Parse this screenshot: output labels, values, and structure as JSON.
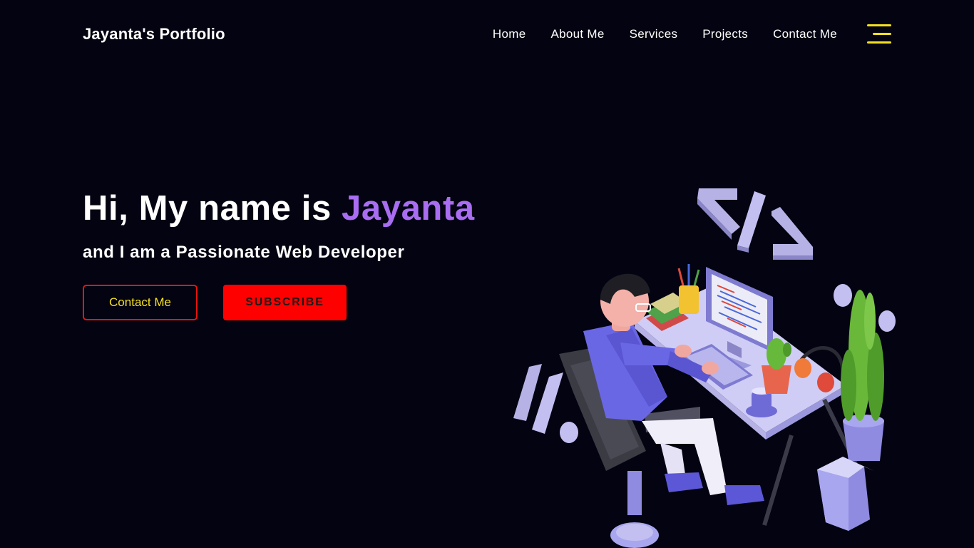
{
  "navbar": {
    "brand": "Jayanta's Portfolio",
    "links": [
      {
        "label": "Home"
      },
      {
        "label": "About Me"
      },
      {
        "label": "Services"
      },
      {
        "label": "Projects"
      },
      {
        "label": "Contact Me"
      }
    ],
    "menu_icon": "hamburger-menu-icon"
  },
  "hero": {
    "title_prefix": "Hi, My name is ",
    "title_name": "Jayanta",
    "subtitle": "and I am a Passionate Web Developer",
    "contact_button": "Contact Me",
    "subscribe_button": "SUBSCRIBE"
  },
  "illustration": {
    "subject": "developer-at-desk-illustration",
    "code_symbol": "</>"
  },
  "colors": {
    "background": "#030311",
    "accent_purple": "#a86df0",
    "accent_yellow": "#f5e21f",
    "accent_red": "#ff0000"
  }
}
